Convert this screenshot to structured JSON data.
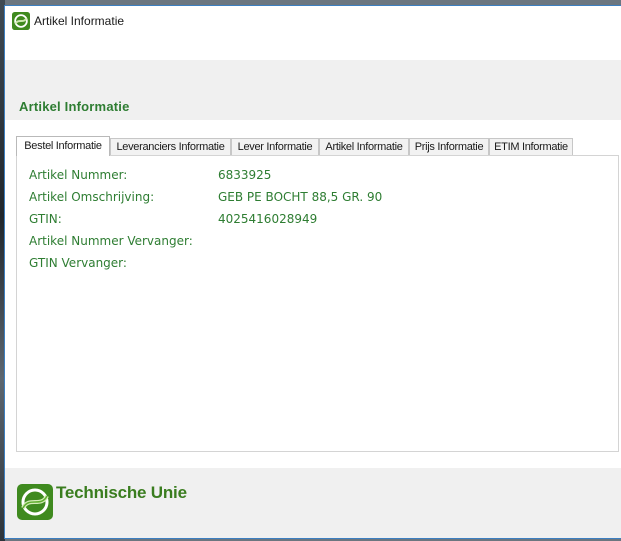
{
  "window": {
    "title": "Artikel Informatie"
  },
  "header": {
    "title": "Artikel Informatie"
  },
  "tabs": [
    {
      "label": "Bestel Informatie",
      "active": true
    },
    {
      "label": "Leveranciers Informatie",
      "active": false
    },
    {
      "label": "Lever Informatie",
      "active": false
    },
    {
      "label": "Artikel Informatie",
      "active": false
    },
    {
      "label": "Prijs Informatie",
      "active": false
    },
    {
      "label": "ETIM Informatie",
      "active": false
    }
  ],
  "fields": [
    {
      "label": "Artikel Nummer:",
      "value": "6833925"
    },
    {
      "label": "Artikel Omschrijving:",
      "value": "GEB PE BOCHT 88,5 GR. 90"
    },
    {
      "label": "GTIN:",
      "value": "4025416028949"
    },
    {
      "label": "Artikel Nummer Vervanger:",
      "value": ""
    },
    {
      "label": "GTIN Vervanger:",
      "value": ""
    }
  ],
  "footer": {
    "brand": "Technische Unie",
    "logo_icon": "technische-unie-logo-icon"
  },
  "colors": {
    "accent_green": "#2e7d32",
    "brand_green": "#3a7d1f",
    "window_border": "#3c7fc1"
  }
}
